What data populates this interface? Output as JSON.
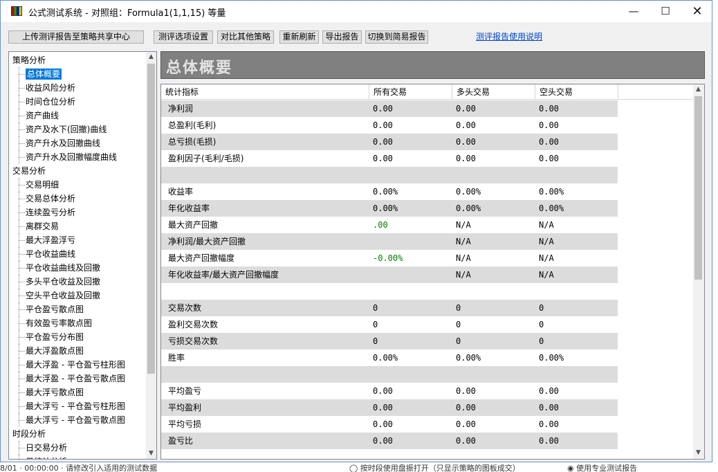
{
  "window": {
    "title": "公式测试系统 - 对照组：Formula1(1,1,15) 等量",
    "minimize_glyph": "—",
    "maximize_glyph": "☐",
    "close_glyph": "✕"
  },
  "toolbar": {
    "upload_label": "上传测评报告至策略共享中心",
    "options_label": "测评选项设置",
    "compare_label": "对比其他策略",
    "refresh_label": "重新刷新",
    "export_label": "导出报告",
    "switch_label": "切换到简易报告",
    "help_link": "测评报告使用说明"
  },
  "tree": {
    "items": [
      {
        "label": "策略分析",
        "level": 0
      },
      {
        "label": "总体概要",
        "level": 1,
        "selected": true
      },
      {
        "label": "收益风险分析",
        "level": 1
      },
      {
        "label": "时间仓位分析",
        "level": 1
      },
      {
        "label": "资产曲线",
        "level": 1
      },
      {
        "label": "资产及水下(回撤)曲线",
        "level": 1
      },
      {
        "label": "资产升水及回撤曲线",
        "level": 1
      },
      {
        "label": "资产升水及回撤幅度曲线",
        "level": 1
      },
      {
        "label": "交易分析",
        "level": 0
      },
      {
        "label": "交易明细",
        "level": 1
      },
      {
        "label": "交易总体分析",
        "level": 1
      },
      {
        "label": "连续盈亏分析",
        "level": 1
      },
      {
        "label": "离群交易",
        "level": 1
      },
      {
        "label": "最大浮盈浮亏",
        "level": 1
      },
      {
        "label": "平仓收益曲线",
        "level": 1
      },
      {
        "label": "平仓收益曲线及回撤",
        "level": 1
      },
      {
        "label": "多头平仓收益及回撤",
        "level": 1
      },
      {
        "label": "空头平仓收益及回撤",
        "level": 1
      },
      {
        "label": "平仓盈亏散点图",
        "level": 1
      },
      {
        "label": "有效盈亏率散点图",
        "level": 1
      },
      {
        "label": "平仓盈亏分布图",
        "level": 1
      },
      {
        "label": "最大浮盈散点图",
        "level": 1
      },
      {
        "label": "最大浮盈 - 平仓盈亏柱形图",
        "level": 1
      },
      {
        "label": "最大浮盈 - 平仓盈亏散点图",
        "level": 1
      },
      {
        "label": "最大浮亏散点图",
        "level": 1
      },
      {
        "label": "最大浮亏 - 平仓盈亏柱形图",
        "level": 1
      },
      {
        "label": "最大浮亏 - 平仓盈亏散点图",
        "level": 1
      },
      {
        "label": "时段分析",
        "level": 0
      },
      {
        "label": "日交易分析",
        "level": 1
      },
      {
        "label": "日统计分析",
        "level": 1
      }
    ]
  },
  "banner": {
    "title": "总体概要"
  },
  "table": {
    "columns": [
      "统计指标",
      "所有交易",
      "多头交易",
      "空头交易"
    ],
    "rows": [
      {
        "label": "净利润",
        "all": "0.00",
        "long": "0.00",
        "short": "0.00"
      },
      {
        "label": "总盈利(毛利)",
        "all": "0.00",
        "long": "0.00",
        "short": "0.00"
      },
      {
        "label": "总亏损(毛损)",
        "all": "0.00",
        "long": "0.00",
        "short": "0.00"
      },
      {
        "label": "盈利因子(毛利/毛损)",
        "all": "0.00",
        "long": "0.00",
        "short": "0.00"
      },
      {
        "label": "",
        "all": "",
        "long": "",
        "short": ""
      },
      {
        "label": "收益率",
        "all": "0.00%",
        "long": "0.00%",
        "short": "0.00%"
      },
      {
        "label": "年化收益率",
        "all": "0.00%",
        "long": "0.00%",
        "short": "0.00%"
      },
      {
        "label": "最大资产回撤",
        "all": ".00",
        "long": "N/A",
        "short": "N/A",
        "all_green": true
      },
      {
        "label": "净利润/最大资产回撤",
        "all": "",
        "long": "N/A",
        "short": "N/A"
      },
      {
        "label": "最大资产回撤幅度",
        "all": "-0.00%",
        "long": "N/A",
        "short": "N/A",
        "all_green": true
      },
      {
        "label": "年化收益率/最大资产回撤幅度",
        "all": "",
        "long": "N/A",
        "short": "N/A"
      },
      {
        "label": "",
        "all": "",
        "long": "",
        "short": ""
      },
      {
        "label": "交易次数",
        "all": "0",
        "long": "0",
        "short": "0"
      },
      {
        "label": "盈利交易次数",
        "all": "0",
        "long": "0",
        "short": "0"
      },
      {
        "label": "亏损交易次数",
        "all": "0",
        "long": "0",
        "short": "0"
      },
      {
        "label": "胜率",
        "all": "0.00%",
        "long": "0.00%",
        "short": "0.00%"
      },
      {
        "label": "",
        "all": "",
        "long": "",
        "short": ""
      },
      {
        "label": "平均盈亏",
        "all": "0.00",
        "long": "0.00",
        "short": "0.00"
      },
      {
        "label": "平均盈利",
        "all": "0.00",
        "long": "0.00",
        "short": "0.00"
      },
      {
        "label": "平均亏损",
        "all": "0.00",
        "long": "0.00",
        "short": "0.00"
      },
      {
        "label": "盈亏比",
        "all": "0.00",
        "long": "0.00",
        "short": "0.00"
      }
    ]
  },
  "colors": {
    "accent": "#0078d7",
    "banner": "#808080",
    "row_alt": "#dcdcdc",
    "green": "#008000"
  },
  "scrollbars": {
    "up_glyph": "▲",
    "down_glyph": "▼"
  },
  "background": {
    "left_text": "8/01 · 00:00:00  ·  请修改引入适用的测试数据",
    "middle_text": "◯ 按时段使用盘振打开（只显示策略的图板成交）",
    "right_text": "◉ 使用专业测试报告"
  }
}
